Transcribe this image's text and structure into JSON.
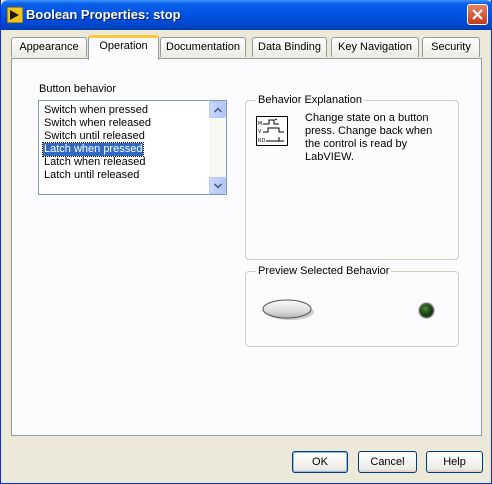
{
  "window": {
    "title": "Boolean Properties: stop"
  },
  "tabs": [
    {
      "label": "Appearance"
    },
    {
      "label": "Operation"
    },
    {
      "label": "Documentation"
    },
    {
      "label": "Data Binding"
    },
    {
      "label": "Key Navigation"
    },
    {
      "label": "Security"
    }
  ],
  "active_tab": "Operation",
  "button_behavior": {
    "label": "Button behavior",
    "items": [
      {
        "label": "Switch when pressed"
      },
      {
        "label": "Switch when released"
      },
      {
        "label": "Switch until released"
      },
      {
        "label": "Latch when pressed"
      },
      {
        "label": "Latch when released"
      },
      {
        "label": "Latch until released"
      }
    ],
    "selected": "Latch when pressed"
  },
  "behavior_explanation": {
    "title": "Behavior Explanation",
    "text": "Change state on a button press.  Change back when the control is read by LabVIEW.",
    "icon": "timing-diagram-icon"
  },
  "preview": {
    "title": "Preview Selected Behavior",
    "button_icon": "boolean-button-icon",
    "led_icon": "led-indicator-icon",
    "led_color": "#1e4a14"
  },
  "footer": {
    "ok_label": "OK",
    "cancel_label": "Cancel",
    "help_label": "Help"
  }
}
